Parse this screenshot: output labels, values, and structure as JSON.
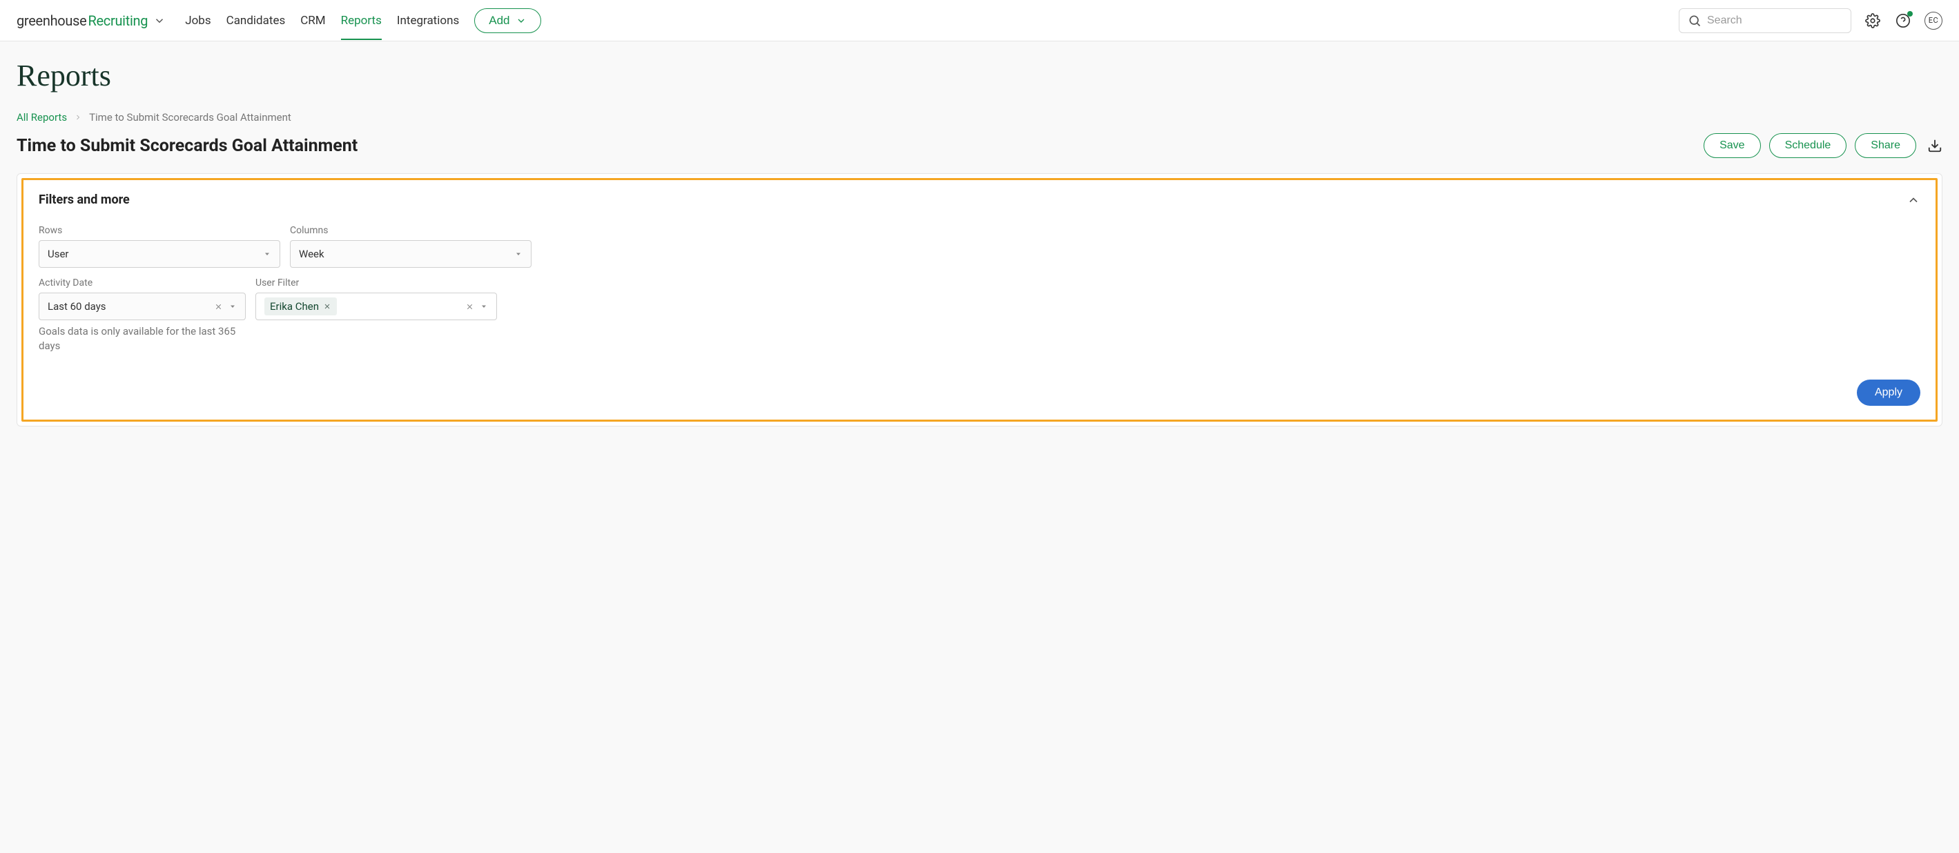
{
  "brand": {
    "part1": "greenhouse",
    "part2": "Recruiting"
  },
  "nav": {
    "jobs": "Jobs",
    "candidates": "Candidates",
    "crm": "CRM",
    "reports": "Reports",
    "integrations": "Integrations",
    "add": "Add"
  },
  "search": {
    "placeholder": "Search"
  },
  "avatar_initials": "EC",
  "page_title": "Reports",
  "breadcrumb": {
    "root": "All Reports",
    "current": "Time to Submit Scorecards Goal Attainment"
  },
  "report_title": "Time to Submit Scorecards Goal Attainment",
  "actions": {
    "save": "Save",
    "schedule": "Schedule",
    "share": "Share"
  },
  "filters": {
    "heading": "Filters and more",
    "rows_label": "Rows",
    "rows_value": "User",
    "columns_label": "Columns",
    "columns_value": "Week",
    "activity_label": "Activity Date",
    "activity_value": "Last 60 days",
    "userfilter_label": "User Filter",
    "userfilter_chip": "Erika Chen",
    "helper": "Goals data is only available for the last 365 days",
    "apply": "Apply"
  }
}
